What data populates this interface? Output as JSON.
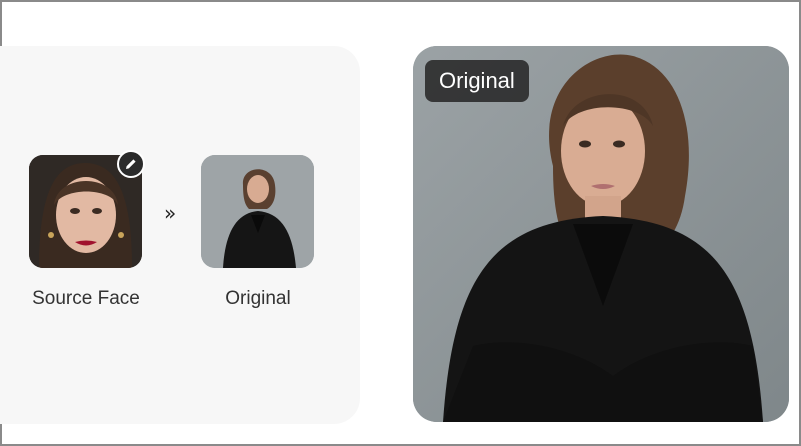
{
  "comparison": {
    "source_label": "Source Face",
    "original_label": "Original",
    "arrow_glyph": "»",
    "edit_icon": "pencil-icon"
  },
  "preview": {
    "badge_label": "Original"
  },
  "colors": {
    "panel_bg": "#f7f7f7",
    "badge_bg": "#2a2a2a",
    "badge_text": "#ffffff",
    "edit_button_bg": "#2b2b2b"
  }
}
